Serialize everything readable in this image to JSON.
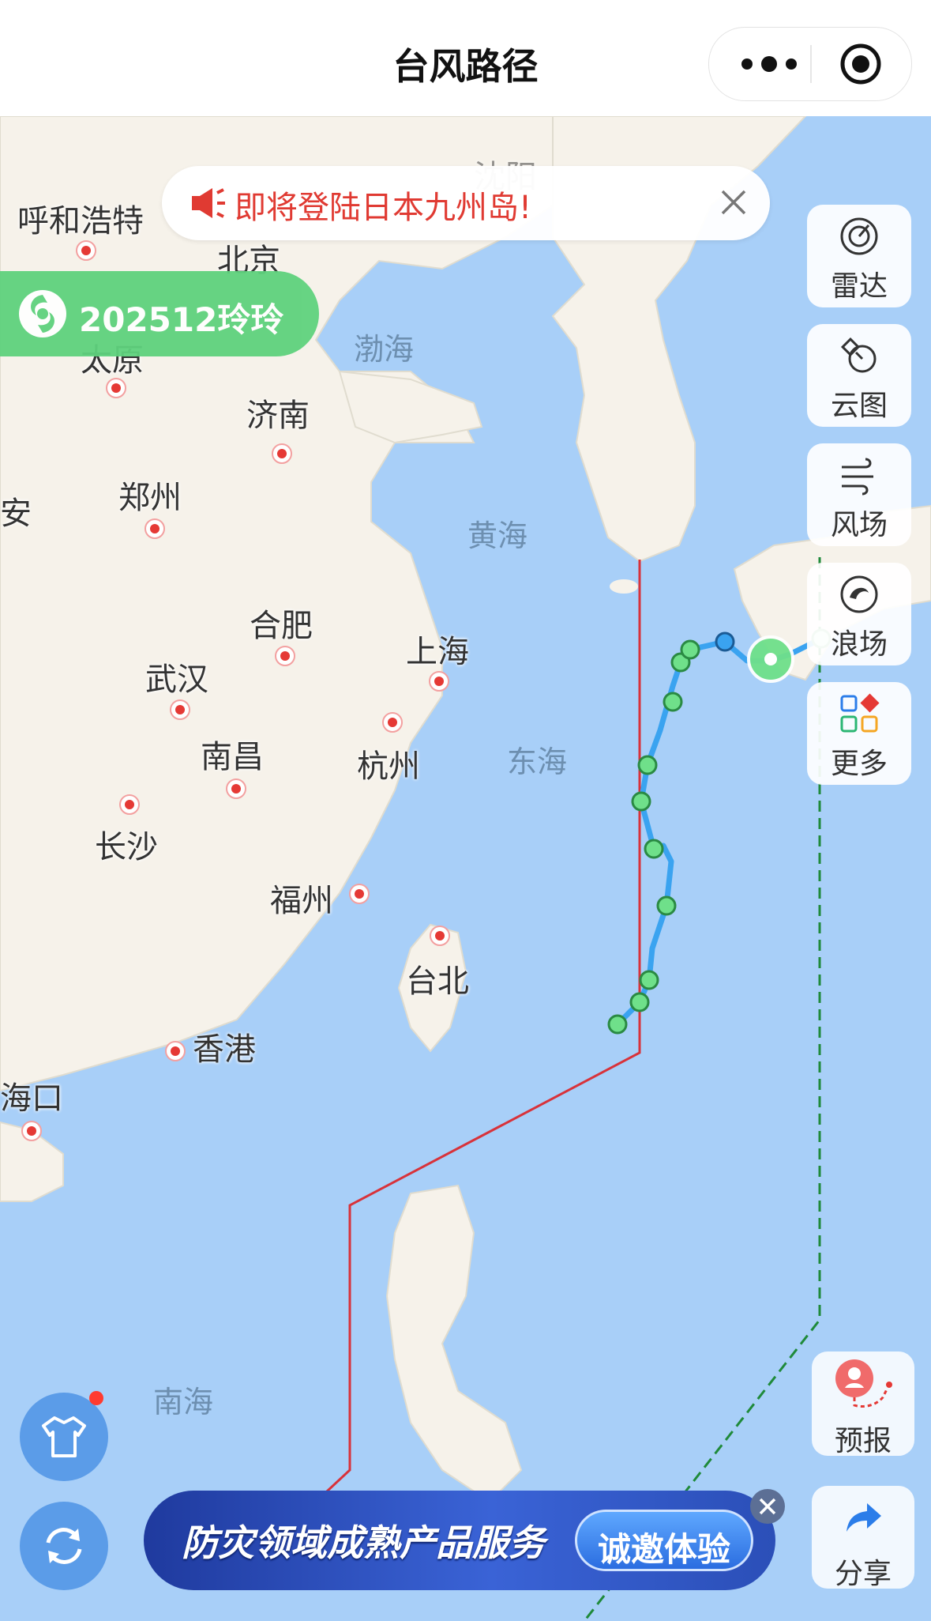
{
  "header": {
    "title": "台风路径"
  },
  "notice": {
    "text": "即将登陆日本九州岛!"
  },
  "typhoon": {
    "name": "202512玲玲",
    "badge_color": "#5fd27d"
  },
  "tools": [
    {
      "label": "雷达",
      "icon": "radar-icon"
    },
    {
      "label": "云图",
      "icon": "satellite-icon"
    },
    {
      "label": "风场",
      "icon": "wind-icon"
    },
    {
      "label": "浪场",
      "icon": "wave-icon"
    },
    {
      "label": "更多",
      "icon": "more-grid-icon"
    }
  ],
  "right_bottom": {
    "forecast": "预报",
    "share": "分享"
  },
  "ad": {
    "title": "防灾领域成熟产品服务",
    "button": "诚邀体验"
  },
  "map": {
    "cities": [
      "呼和浩特",
      "北京",
      "太原",
      "济南",
      "郑州",
      "合肥",
      "上海",
      "武汉",
      "南昌",
      "杭州",
      "长沙",
      "福州",
      "台北",
      "香港",
      "海口",
      "沈阳",
      "安"
    ],
    "seas": [
      "渤海",
      "黄海",
      "东海",
      "南海"
    ],
    "track_color": "#3aa3f0",
    "point_color": "#6fe08a",
    "line_24h_color": "#d8323a",
    "line_48h_color": "#1f8a3a"
  }
}
